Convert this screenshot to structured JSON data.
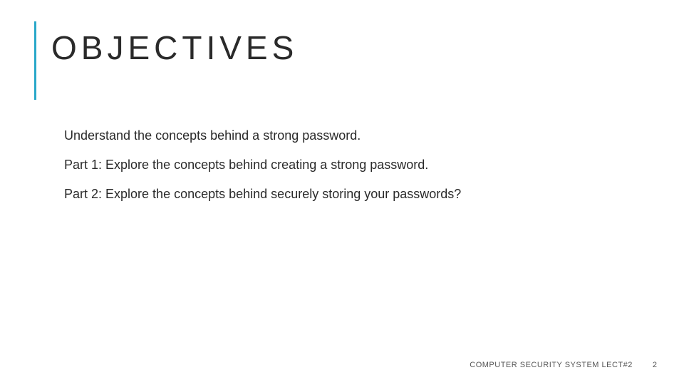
{
  "slide": {
    "title": "OBJECTIVES",
    "body": [
      "Understand the concepts behind a strong password.",
      "Part 1: Explore the concepts behind creating a strong password.",
      "Part 2: Explore the concepts behind securely storing your passwords?"
    ],
    "footer_label": "COMPUTER SECURITY SYSTEM LECT#2",
    "page_number": "2"
  }
}
